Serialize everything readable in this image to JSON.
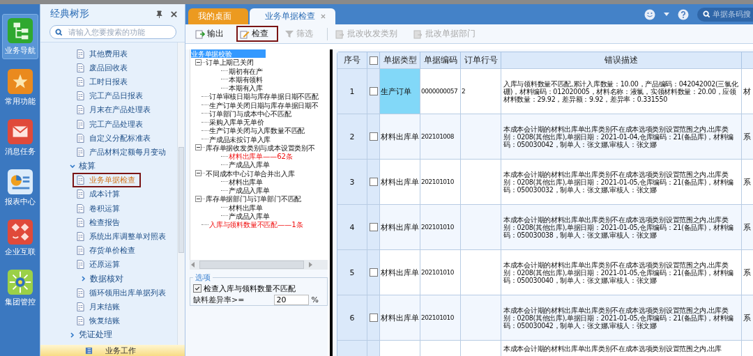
{
  "nav": [
    {
      "label": "业务导航",
      "selected": true
    },
    {
      "label": "常用功能",
      "selected": false
    },
    {
      "label": "消息任务",
      "selected": false
    },
    {
      "label": "报表中心",
      "selected": false
    },
    {
      "label": "企业互联",
      "selected": false
    },
    {
      "label": "集团管控",
      "selected": false
    }
  ],
  "sidebar": {
    "title": "经典树形",
    "search_placeholder": "请输入您要搜索的功能",
    "items": [
      {
        "kind": "leaf",
        "label": "其他费用表",
        "selected": false,
        "highlighted": false
      },
      {
        "kind": "leaf",
        "label": "废品回收表",
        "selected": false,
        "highlighted": false
      },
      {
        "kind": "leaf",
        "label": "工时日报表",
        "selected": false,
        "highlighted": false
      },
      {
        "kind": "leaf",
        "label": "完工产品日报表",
        "selected": false,
        "highlighted": false
      },
      {
        "kind": "leaf",
        "label": "月末在产品处理表",
        "selected": false,
        "highlighted": false
      },
      {
        "kind": "leaf",
        "label": "完工产品处理表",
        "selected": false,
        "highlighted": false
      },
      {
        "kind": "leaf",
        "label": "自定义分配标准表",
        "selected": false,
        "highlighted": false
      },
      {
        "kind": "leaf",
        "label": "产品材料定额每月变动",
        "selected": false,
        "highlighted": false
      },
      {
        "kind": "group",
        "label": "核算",
        "expanded": true,
        "children": [
          {
            "kind": "leaf",
            "label": "业务单据检查",
            "selected": true,
            "highlighted": true
          },
          {
            "kind": "leaf",
            "label": "成本计算",
            "selected": false,
            "highlighted": false
          },
          {
            "kind": "leaf",
            "label": "卷积运算",
            "selected": false,
            "highlighted": false
          },
          {
            "kind": "leaf",
            "label": "检查报告",
            "selected": false,
            "highlighted": false
          },
          {
            "kind": "leaf",
            "label": "系统出库调整单对照表",
            "selected": false,
            "highlighted": false
          },
          {
            "kind": "leaf",
            "label": "存货单价检查",
            "selected": false,
            "highlighted": false
          },
          {
            "kind": "leaf",
            "label": "还原运算",
            "selected": false,
            "highlighted": false
          },
          {
            "kind": "group",
            "label": "数据核对",
            "expanded": false
          },
          {
            "kind": "leaf",
            "label": "循环领用出库单据列表",
            "selected": false,
            "highlighted": false
          },
          {
            "kind": "leaf",
            "label": "月末结账",
            "selected": false,
            "highlighted": false
          },
          {
            "kind": "leaf",
            "label": "恢复结账",
            "selected": false,
            "highlighted": false
          }
        ]
      },
      {
        "kind": "group",
        "label": "凭证处理",
        "expanded": false
      }
    ],
    "bottom_tab": "业务工作"
  },
  "tabs": [
    {
      "label": "我的桌面",
      "selected": false,
      "closable": false
    },
    {
      "label": "业务单据检查",
      "selected": true,
      "closable": true
    }
  ],
  "barcode_search": {
    "placeholder": "单据条码搜"
  },
  "toolbar": [
    {
      "label": "输出",
      "disabled": false,
      "highlighted": false
    },
    {
      "label": "检查",
      "disabled": false,
      "highlighted": true
    },
    {
      "label": "筛选",
      "disabled": true,
      "highlighted": false
    },
    {
      "label": "批改收发类别",
      "disabled": true,
      "highlighted": false
    },
    {
      "label": "批改单据部门",
      "disabled": true,
      "highlighted": false
    }
  ],
  "check_tree": {
    "nodes": [
      {
        "label": "业务单据校验",
        "selected": true,
        "flagged": false,
        "children": [
          {
            "label": "订单上期已关闭",
            "selected": false,
            "flagged": false,
            "expanded": true,
            "children": [
              {
                "label": "期初有在产",
                "selected": false,
                "flagged": false
              },
              {
                "label": "本期有领料",
                "selected": false,
                "flagged": false
              },
              {
                "label": "本期有入库",
                "selected": false,
                "flagged": false
              }
            ]
          },
          {
            "label": "订单审核日期与库存单据日期不匹配",
            "selected": false,
            "flagged": false
          },
          {
            "label": "生产订单关闭日期与库存单据日期不",
            "selected": false,
            "flagged": false
          },
          {
            "label": "订单部门与成本中心不匹配",
            "selected": false,
            "flagged": false
          },
          {
            "label": "采购入库单无单价",
            "selected": false,
            "flagged": false
          },
          {
            "label": "生产订单关闭与入库数量不匹配",
            "selected": false,
            "flagged": false
          },
          {
            "label": "产成品未按订单入库",
            "selected": false,
            "flagged": false
          },
          {
            "label": "库存单据收发类别与成本设置类别不",
            "selected": false,
            "flagged": false,
            "expanded": true,
            "children": [
              {
                "label": "材料出库单——62条",
                "selected": false,
                "flagged": true
              },
              {
                "label": "产成品入库单",
                "selected": false,
                "flagged": false
              }
            ]
          },
          {
            "label": "不同成本中心订单合并出入库",
            "selected": false,
            "flagged": false,
            "expanded": true,
            "children": [
              {
                "label": "材料出库单",
                "selected": false,
                "flagged": false
              },
              {
                "label": "产成品入库单",
                "selected": false,
                "flagged": false
              }
            ]
          },
          {
            "label": "库存单据部门与订单部门不匹配",
            "selected": false,
            "flagged": false,
            "expanded": true,
            "children": [
              {
                "label": "材料出库单",
                "selected": false,
                "flagged": false
              },
              {
                "label": "产成品入库单",
                "selected": false,
                "flagged": false
              }
            ]
          },
          {
            "label": "入库与领料数量不匹配——1条",
            "selected": false,
            "flagged": true
          }
        ]
      }
    ]
  },
  "options": {
    "title": "选项",
    "check_label": "检查入库与领料数量不匹配",
    "checked": true,
    "rate_label": "缺料差异率>=",
    "rate_value": "20",
    "rate_unit": "%"
  },
  "table": {
    "columns": [
      "序号",
      "",
      "单据类型",
      "单据编码",
      "订单行号",
      "错误描述"
    ],
    "header_checked": false,
    "rows": [
      {
        "no": "1",
        "checked": false,
        "type": "生产订单",
        "selected": true,
        "code": "0000000057",
        "line": "2",
        "desc": "入库与领料数量不匹配,累计入库数量：10.00，产品编码：042042002(三氯化硼)，材料编码：012020005，材料名称：液氯，实领材料数量：20.00，应领材料数量：29.92，差异额：9.92，差异率：0.331550",
        "column_7": "材"
      },
      {
        "no": "2",
        "checked": false,
        "type": "材料出库单",
        "selected": false,
        "code": "202101008",
        "line": "",
        "desc": "本成本会计期的材料出库单出库类别不在成本选项类别设置范围之内,出库类别：0208(其他出库),单据日期：2021-01-04,仓库编码：21(备品库)，材料编码：050030042，制单人：张文娜,审核人：张文娜",
        "column_7": "系"
      },
      {
        "no": "3",
        "checked": false,
        "type": "材料出库单",
        "selected": false,
        "code": "202101010",
        "line": "",
        "desc": "本成本会计期的材料出库单出库类别不在成本选项类别设置范围之内,出库类别：0208(其他出库),单据日期：2021-01-05,仓库编码：21(备品库)，材料编码：050030032，制单人：张文娜,审核人：张文娜",
        "column_7": "系"
      },
      {
        "no": "4",
        "checked": false,
        "type": "材料出库单",
        "selected": false,
        "code": "202101010",
        "line": "",
        "desc": "本成本会计期的材料出库单出库类别不在成本选项类别设置范围之内,出库类别：0208(其他出库),单据日期：2021-01-05,仓库编码：21(备品库)，材料编码：050030038，制单人：张文娜,审核人：张文娜",
        "column_7": "系"
      },
      {
        "no": "5",
        "checked": false,
        "type": "材料出库单",
        "selected": false,
        "code": "202101010",
        "line": "",
        "desc": "本成本会计期的材料出库单出库类别不在成本选项类别设置范围之内,出库类别：0208(其他出库),单据日期：2021-01-05,仓库编码：21(备品库)，材料编码：050030040，制单人：张文娜,审核人：张文娜",
        "column_7": "系"
      },
      {
        "no": "6",
        "checked": false,
        "type": "材料出库单",
        "selected": false,
        "code": "202101010",
        "line": "",
        "desc": "本成本会计期的材料出库单出库类别不在成本选项类别设置范围之内,出库类别：0208(其他出库),单据日期：2021-01-05,仓库编码：21(备品库)，材料编码：050030042，制单人：张文娜,审核人：张文娜",
        "column_7": "系"
      }
    ],
    "partial_row": {
      "desc": "本成本会计期的材料出库单出库类别不在成本选项类别设置范围之内,出库"
    }
  }
}
